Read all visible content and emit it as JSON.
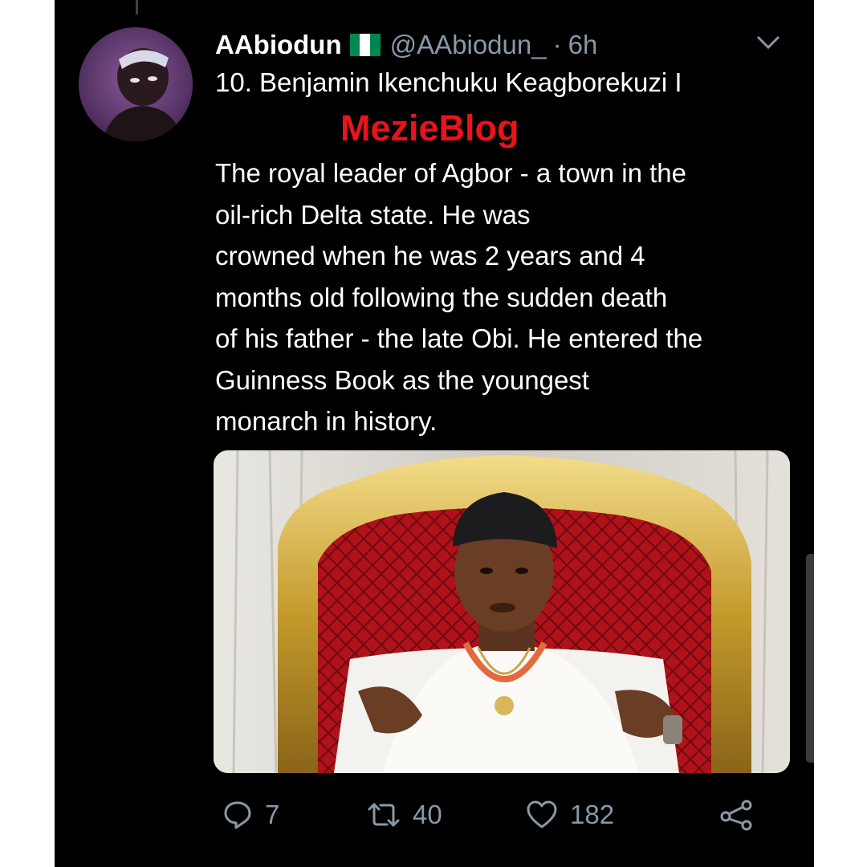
{
  "tweet": {
    "display_name": "AAbiodun",
    "handle": "@AAbiodun_",
    "separator": "·",
    "time": "6h",
    "title": "10. Benjamin Ikenchuku Keagborekuzi I",
    "watermark": "MezieBlog",
    "body": "The royal leader of Agbor - a town in the\noil-rich Delta state. He was\ncrowned when he was 2 years and 4\nmonths old following the sudden death\nof his father - the late Obi. He entered the\nGuinness Book as the youngest\nmonarch in history."
  },
  "actions": {
    "replies": "7",
    "retweets": "40",
    "likes": "182"
  },
  "icons": {
    "flag": "nigeria-flag-icon",
    "caret": "chevron-down-icon",
    "reply": "reply-icon",
    "retweet": "retweet-icon",
    "like": "heart-icon",
    "share": "share-icon"
  },
  "colors": {
    "background": "#000000",
    "text": "#ffffff",
    "secondary_text": "#8899a6",
    "watermark": "#e8131b",
    "flag_green": "#008751",
    "flag_white": "#ffffff"
  }
}
